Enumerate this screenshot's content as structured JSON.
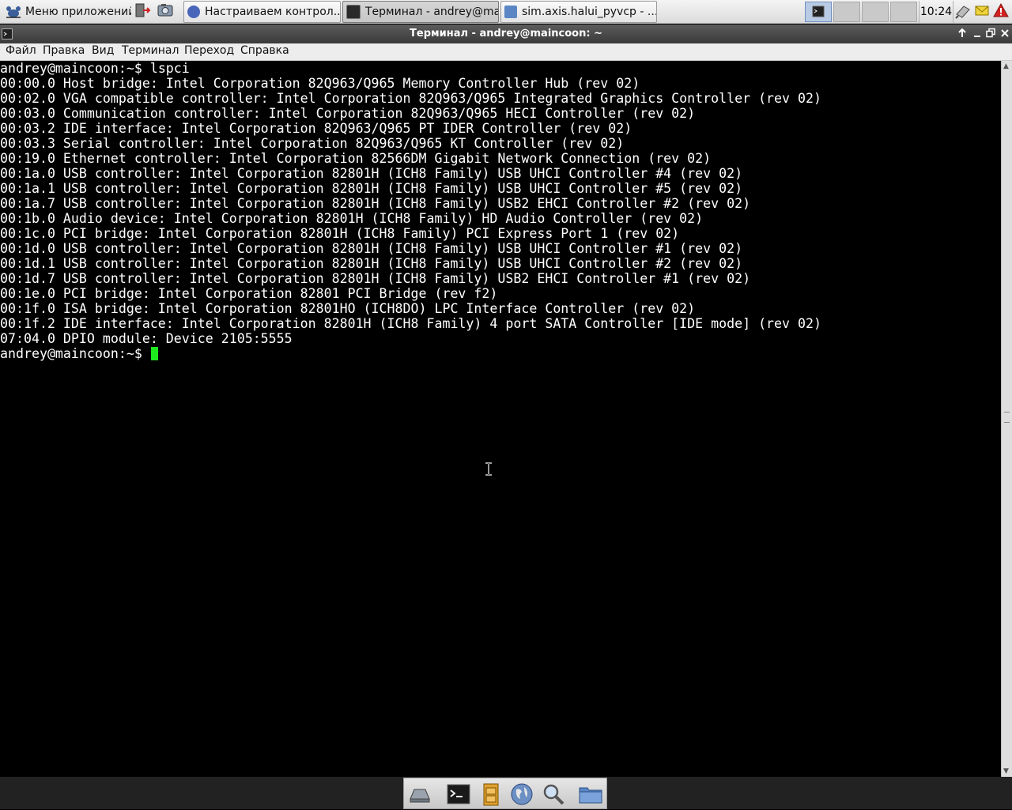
{
  "top_panel": {
    "app_menu_label": "Меню приложений",
    "tasks": [
      {
        "label": "Настраиваем контрол...",
        "active": false
      },
      {
        "label": "Терминал - andrey@ma...",
        "active": true
      },
      {
        "label": "sim.axis.halui_pyvcp - ...",
        "active": false
      }
    ],
    "clock": "10:24"
  },
  "window": {
    "title": "Терминал - andrey@maincoon: ~",
    "menu": [
      "Файл",
      "Правка",
      "Вид",
      "Терминал",
      "Переход",
      "Справка"
    ]
  },
  "terminal": {
    "prompt": "andrey@maincoon:~$",
    "command": "lspci",
    "output": [
      "00:00.0 Host bridge: Intel Corporation 82Q963/Q965 Memory Controller Hub (rev 02)",
      "00:02.0 VGA compatible controller: Intel Corporation 82Q963/Q965 Integrated Graphics Controller (rev 02)",
      "00:03.0 Communication controller: Intel Corporation 82Q963/Q965 HECI Controller (rev 02)",
      "00:03.2 IDE interface: Intel Corporation 82Q963/Q965 PT IDER Controller (rev 02)",
      "00:03.3 Serial controller: Intel Corporation 82Q963/Q965 KT Controller (rev 02)",
      "00:19.0 Ethernet controller: Intel Corporation 82566DM Gigabit Network Connection (rev 02)",
      "00:1a.0 USB controller: Intel Corporation 82801H (ICH8 Family) USB UHCI Controller #4 (rev 02)",
      "00:1a.1 USB controller: Intel Corporation 82801H (ICH8 Family) USB UHCI Controller #5 (rev 02)",
      "00:1a.7 USB controller: Intel Corporation 82801H (ICH8 Family) USB2 EHCI Controller #2 (rev 02)",
      "00:1b.0 Audio device: Intel Corporation 82801H (ICH8 Family) HD Audio Controller (rev 02)",
      "00:1c.0 PCI bridge: Intel Corporation 82801H (ICH8 Family) PCI Express Port 1 (rev 02)",
      "00:1d.0 USB controller: Intel Corporation 82801H (ICH8 Family) USB UHCI Controller #1 (rev 02)",
      "00:1d.1 USB controller: Intel Corporation 82801H (ICH8 Family) USB UHCI Controller #2 (rev 02)",
      "00:1d.7 USB controller: Intel Corporation 82801H (ICH8 Family) USB2 EHCI Controller #1 (rev 02)",
      "00:1e.0 PCI bridge: Intel Corporation 82801 PCI Bridge (rev f2)",
      "00:1f.0 ISA bridge: Intel Corporation 82801HO (ICH8DO) LPC Interface Controller (rev 02)",
      "00:1f.2 IDE interface: Intel Corporation 82801H (ICH8 Family) 4 port SATA Controller [IDE mode] (rev 02)",
      "07:04.0 DPIO module: Device 2105:5555"
    ]
  },
  "colors": {
    "terminal_bg": "#000000",
    "terminal_fg": "#ffffff",
    "cursor": "#1ee81e"
  },
  "icons": {
    "app_menu": "mouse-logo-icon",
    "dock": [
      "disk-icon",
      "terminal-icon",
      "file-cabinet-icon",
      "web-browser-icon",
      "search-icon",
      "folder-icon"
    ]
  }
}
